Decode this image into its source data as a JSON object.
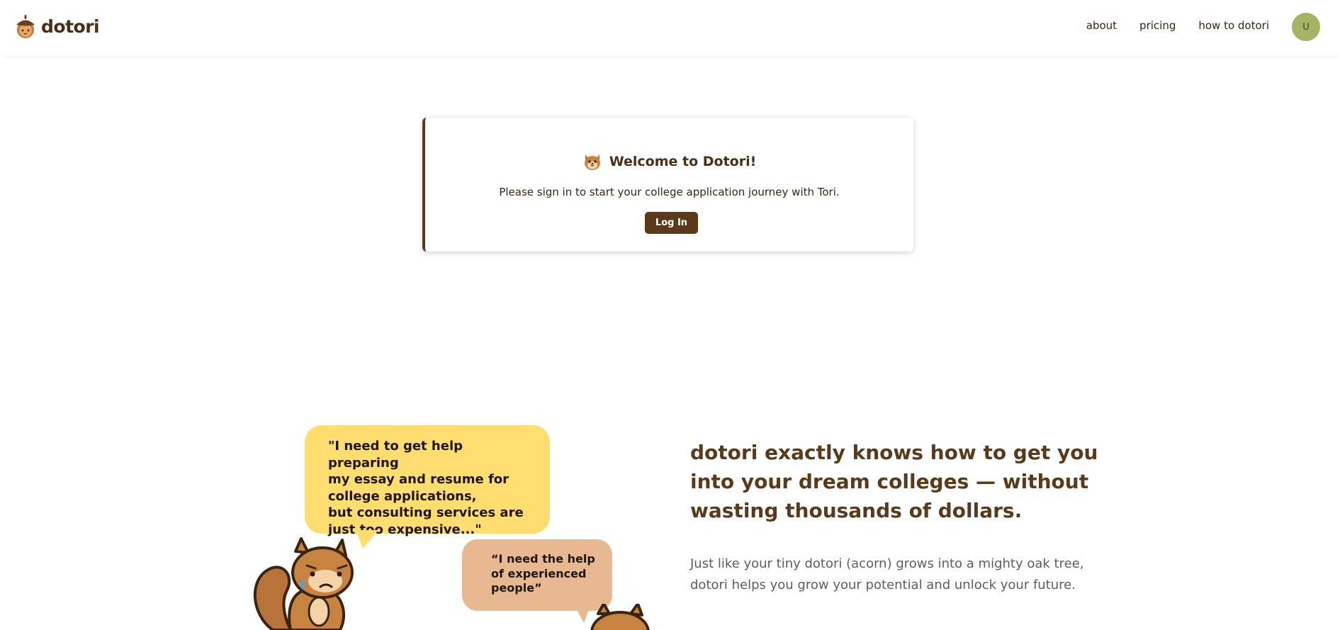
{
  "header": {
    "brand_name": "dotori",
    "nav": [
      {
        "label": "about"
      },
      {
        "label": "pricing"
      },
      {
        "label": "how to dotori"
      }
    ],
    "avatar_initial": "U"
  },
  "welcome_card": {
    "title": "Welcome to Dotori!",
    "subtitle": "Please sign in to start your college application journey with Tori.",
    "login_label": "Log In"
  },
  "hero": {
    "bubble_one": "\"I need to get help preparing\nmy essay and resume for\ncollege applications,\nbut consulting services are\njust too expensive...\"",
    "bubble_two": "“I need the help\nof experienced\npeople”",
    "heading": "dotori exactly knows how to get you into your dream colleges — without wasting thousands of dollars.",
    "text": "Just like your tiny dotori (acorn) grows into a mighty oak tree, dotori helps you grow your potential and unlock your future."
  },
  "colors": {
    "brand_brown": "#5b3a1a",
    "avatar_green": "#a4b465",
    "bubble_yellow": "#ffdd6e",
    "bubble_tan": "#e8b890"
  },
  "icons": [
    "acorn-logo-icon",
    "squirrel-face-icon",
    "worried-squirrel-illustration",
    "squirrel-illustration"
  ]
}
